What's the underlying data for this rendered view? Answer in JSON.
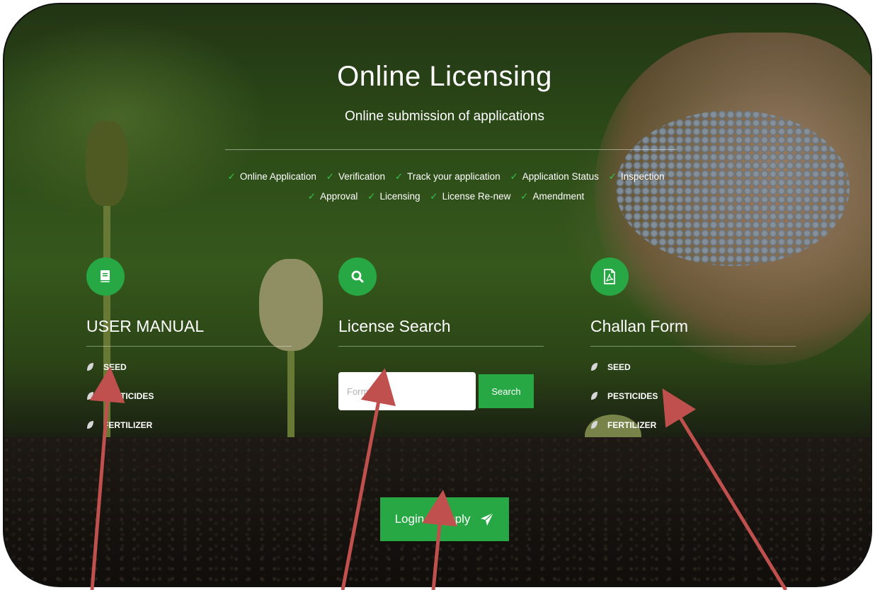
{
  "hero": {
    "title": "Online Licensing",
    "subtitle": "Online submission of applications",
    "features_row1": [
      "Online Application",
      "Verification",
      "Track your application",
      "Application Status",
      "Inspection"
    ],
    "features_row2": [
      "Approval",
      "Licensing",
      "License Re-new",
      "Amendment"
    ],
    "check_glyph": "✓"
  },
  "user_manual": {
    "icon": "book-icon",
    "title": "USER MANUAL",
    "links": [
      "SEED",
      "PESTICIDES",
      "FERTILIZER"
    ]
  },
  "license_search": {
    "icon": "search-icon",
    "title": "License Search",
    "input_placeholder": "Form No.",
    "button_label": "Search"
  },
  "challan_form": {
    "icon": "pdf-icon",
    "title": "Challan Form",
    "links": [
      "SEED",
      "PESTICIDES",
      "FERTILIZER"
    ]
  },
  "login": {
    "label": "Login to Apply",
    "icon": "paper-plane-icon"
  },
  "colors": {
    "accent_green": "#27a844",
    "check_green": "#35c24b",
    "annotation_arrow": "#c0504d"
  }
}
